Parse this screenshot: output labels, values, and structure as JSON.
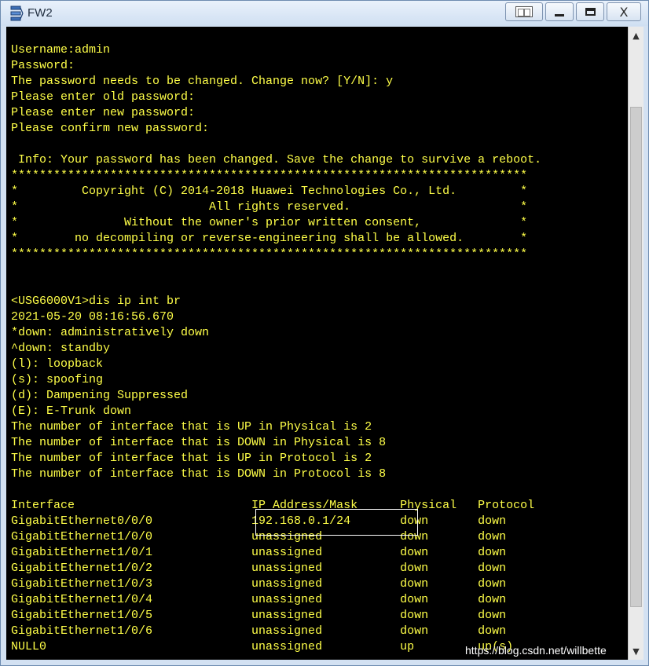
{
  "window": {
    "title": "FW2",
    "app_icon": "network-device-icon",
    "controls": {
      "extra": "window-layout-icon",
      "minimize": "minimize-icon",
      "maximize": "maximize-icon",
      "close_label": "X"
    }
  },
  "terminal": {
    "colors": {
      "background": "#000000",
      "text": "#ffff48",
      "highlight_border": "#ffffff"
    },
    "lines": [
      "Username:admin",
      "Password:",
      "The password needs to be changed. Change now? [Y/N]: y",
      "Please enter old password:",
      "Please enter new password:",
      "Please confirm new password:",
      "",
      " Info: Your password has been changed. Save the change to survive a reboot.",
      "*************************************************************************",
      "*         Copyright (C) 2014-2018 Huawei Technologies Co., Ltd.         *",
      "*                           All rights reserved.                        *",
      "*               Without the owner's prior written consent,              *",
      "*        no decompiling or reverse-engineering shall be allowed.        *",
      "*************************************************************************",
      "",
      "",
      "<USG6000V1>dis ip int br",
      "2021-05-20 08:16:56.670",
      "*down: administratively down",
      "^down: standby",
      "(l): loopback",
      "(s): spoofing",
      "(d): Dampening Suppressed",
      "(E): E-Trunk down",
      "The number of interface that is UP in Physical is 2",
      "The number of interface that is DOWN in Physical is 8",
      "The number of interface that is UP in Protocol is 2",
      "The number of interface that is DOWN in Protocol is 8",
      "",
      "Interface                         IP Address/Mask      Physical   Protocol",
      "GigabitEthernet0/0/0              192.168.0.1/24       down       down",
      "GigabitEthernet1/0/0              unassigned           down       down",
      "GigabitEthernet1/0/1              unassigned           down       down",
      "GigabitEthernet1/0/2              unassigned           down       down",
      "GigabitEthernet1/0/3              unassigned           down       down",
      "GigabitEthernet1/0/4              unassigned           down       down",
      "GigabitEthernet1/0/5              unassigned           down       down",
      "GigabitEthernet1/0/6              unassigned           down       down",
      "NULL0                             unassigned           up         up(s)"
    ],
    "watermark": "https://blog.csdn.net/willbette"
  },
  "scrollbar": {
    "up_icon": "scroll-up-arrow-icon",
    "down_icon": "scroll-down-arrow-icon",
    "up_glyph": "▲",
    "down_glyph": "▼"
  }
}
